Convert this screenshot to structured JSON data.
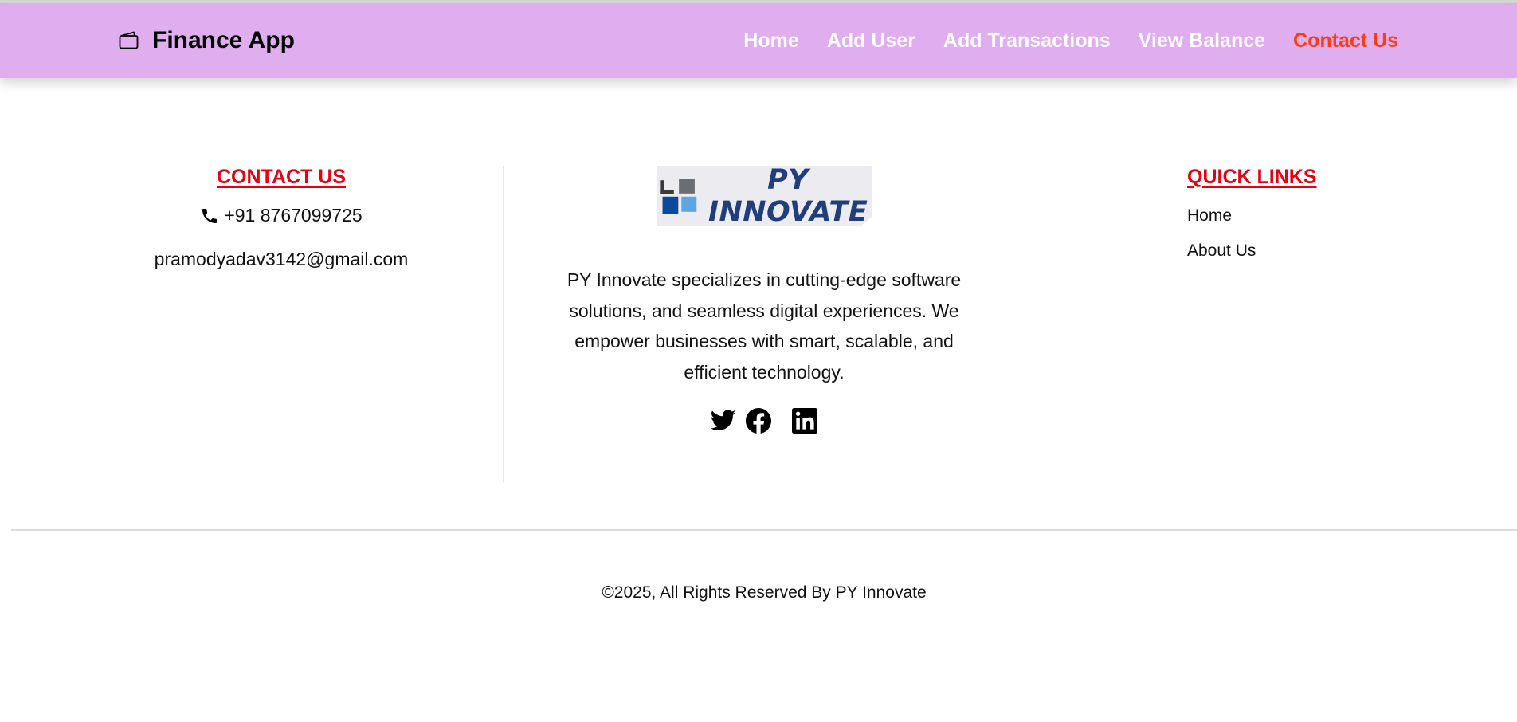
{
  "navbar": {
    "brand_icon": "wallet-icon",
    "brand": "Finance App",
    "links": [
      {
        "label": "Home",
        "active": false
      },
      {
        "label": "Add User",
        "active": false
      },
      {
        "label": "Add Transactions",
        "active": false
      },
      {
        "label": "View Balance",
        "active": false
      },
      {
        "label": "Contact Us",
        "active": true
      }
    ],
    "background": "#e0aeee",
    "active_color": "#ff3b14"
  },
  "contact": {
    "heading": "CONTACT US",
    "phone_icon": "phone-icon",
    "phone": "+91 8767099725",
    "email": "pramodyadav3142@gmail.com",
    "heading_color": "#e8000f"
  },
  "company": {
    "logo_text": "PY INNOVATE",
    "description": "PY Innovate specializes in cutting-edge software solutions, and seamless digital experiences. We empower businesses with smart, scalable, and efficient technology.",
    "social_icons": [
      "twitter-icon",
      "facebook-icon",
      "linkedin-icon"
    ]
  },
  "quick_links": {
    "heading": "QUICK LINKS",
    "items": [
      "Home",
      "About Us"
    ]
  },
  "footer": {
    "copyright": "©2025, All Rights Reserved By PY Innovate"
  }
}
